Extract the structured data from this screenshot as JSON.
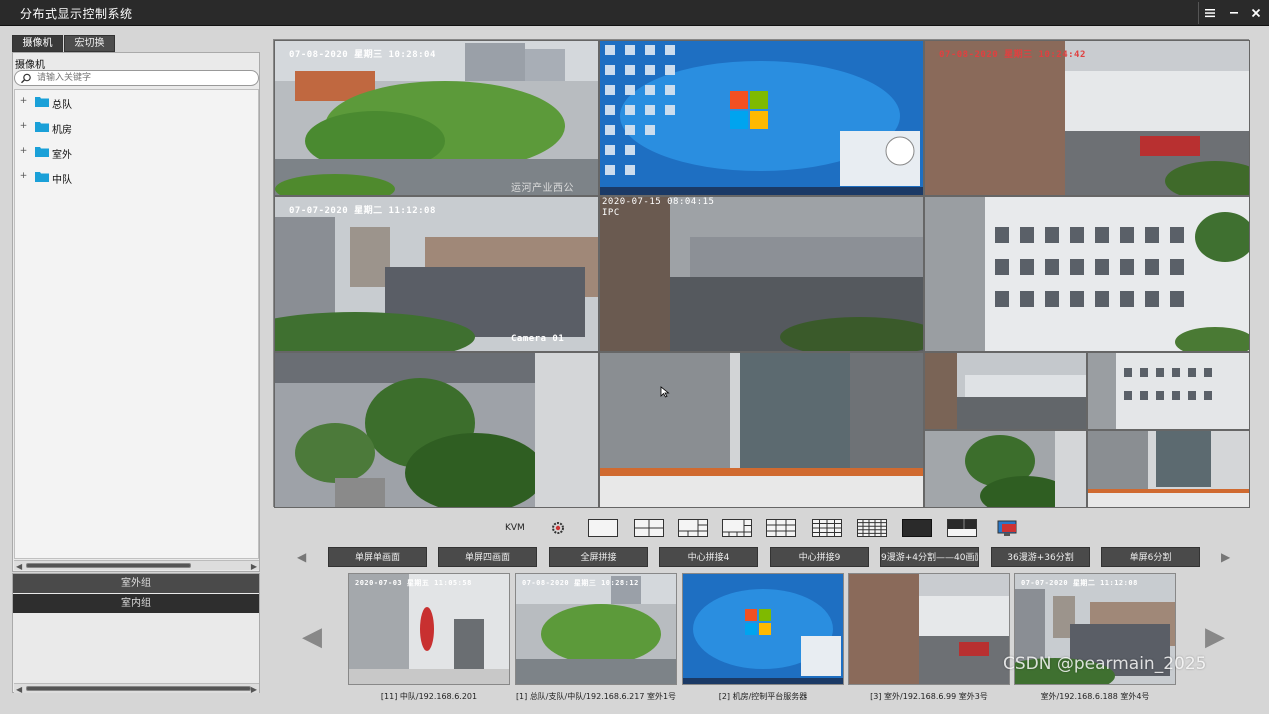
{
  "window": {
    "title": "分布式显示控制系统",
    "menu_icon": "menu-icon",
    "minimize_icon": "minimize-icon",
    "close_icon": "close-icon"
  },
  "left_panel": {
    "tabs": [
      {
        "label": "摄像机",
        "active": true
      },
      {
        "label": "宏切换",
        "active": false
      }
    ],
    "section_label": "摄像机",
    "search": {
      "placeholder": "请输入关键字",
      "value": ""
    },
    "tree": [
      {
        "label": "总队"
      },
      {
        "label": "机房"
      },
      {
        "label": "室外"
      },
      {
        "label": "中队"
      }
    ],
    "groups": [
      {
        "label": "室外组"
      },
      {
        "label": "室内组"
      }
    ]
  },
  "wall": {
    "cells": [
      {
        "osd": "07-08-2020  星期三  10:28:04",
        "caption": "运河产业西公"
      },
      {
        "osd": ""
      },
      {
        "osd": "07-08-2020  星期三  10:24:42"
      },
      {
        "osd": "07-07-2020  星期二  11:12:08",
        "caption": "Camera 01"
      },
      {
        "osd": "2020-07-15 08:04:15",
        "sub": "IPC"
      },
      {
        "osd": ""
      },
      {
        "osd": ""
      },
      {
        "osd": ""
      },
      {
        "osd": ""
      }
    ]
  },
  "layout_toolbar": {
    "kvm_label": "KVM"
  },
  "modes": [
    {
      "label": "单屏单画面"
    },
    {
      "label": "单屏四画面"
    },
    {
      "label": "全屏拼接"
    },
    {
      "label": "中心拼接4"
    },
    {
      "label": "中心拼接9"
    },
    {
      "label": "9漫游+4分割——40画面"
    },
    {
      "label": "36漫游+36分割"
    },
    {
      "label": "单屏6分割"
    }
  ],
  "thumbnails": [
    {
      "osd": "2020-07-03 星期五 11:05:58",
      "caption": "[11] 中队/192.168.6.201"
    },
    {
      "osd": "07-08-2020 星期三 10:28:12",
      "caption": "[1] 总队/支队/中队/192.168.6.217  室外1号"
    },
    {
      "osd": "",
      "caption": "[2] 机房/控制平台服务器"
    },
    {
      "osd": "",
      "caption": "[3] 室外/192.168.6.99  室外3号"
    },
    {
      "osd": "07-07-2020 星期二 11:12:08",
      "caption": "室外/192.168.6.188  室外4号"
    }
  ],
  "watermark": "CSDN @pearmain_2025"
}
